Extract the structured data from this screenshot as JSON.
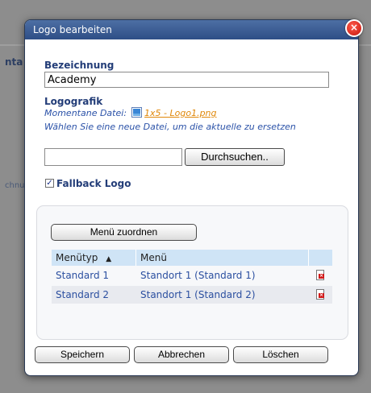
{
  "background": {
    "fragment_top": "nta",
    "fragment_mid": "chnu"
  },
  "dialog": {
    "title": "Logo bearbeiten",
    "close_symbol": "×",
    "bezeichnung_label": "Bezeichnung",
    "bezeichnung_value": "Academy",
    "logografik_label": "Logografik",
    "current_file_label": "Momentane Datei:",
    "current_file_name": "1x5 - Logo1.png",
    "choose_file_hint": "Wählen Sie eine neue Datei, um die aktuelle zu ersetzen",
    "file_input_value": "",
    "browse_button": "Durchsuchen..",
    "fallback_label": "Fallback Logo",
    "fallback_checked": true
  },
  "menu_panel": {
    "assign_button": "Menü zuordnen",
    "columns": {
      "type": "Menütyp",
      "menu": "Menü"
    },
    "sort_indicator": "▲",
    "rows": [
      {
        "type": "Standard 1",
        "menu": "Standort 1 (Standard 1)"
      },
      {
        "type": "Standard 2",
        "menu": "Standort 1 (Standard 2)"
      }
    ]
  },
  "footer": {
    "save": "Speichern",
    "cancel": "Abbrechen",
    "delete": "Löschen"
  },
  "colors": {
    "header": "#2e4e86",
    "label": "#233d78",
    "hint": "#2b52a8",
    "file_link": "#e0880a",
    "table_header": "#cfe4f6",
    "close": "#c4160e"
  }
}
